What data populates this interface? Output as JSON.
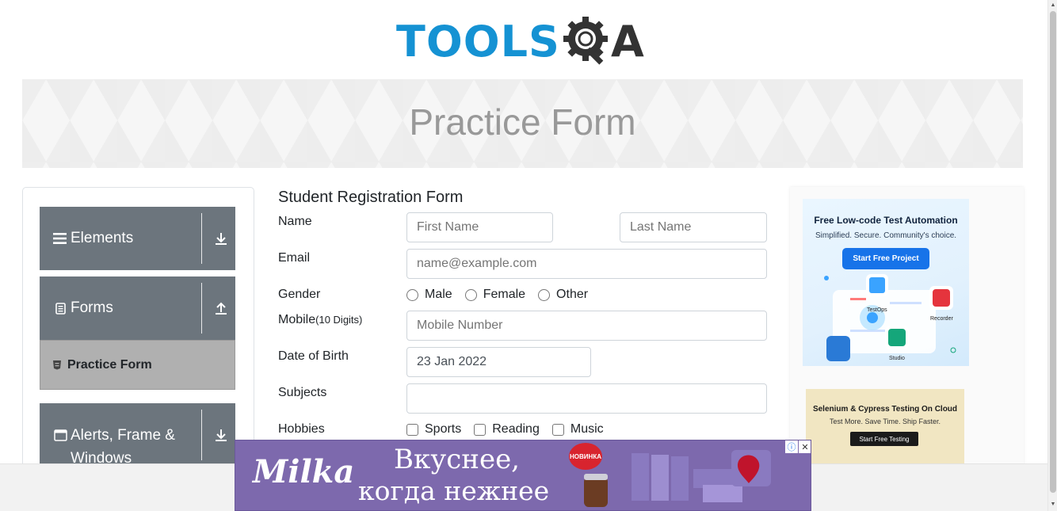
{
  "header": {
    "logo_text": "TOOLS",
    "logo_q_alt": "QA",
    "logo_a": "A"
  },
  "banner": {
    "title": "Practice Form"
  },
  "sidebar": {
    "groups": [
      {
        "label": "Elements",
        "icon": "hamburger-icon",
        "arrow": "download-arrow-icon"
      },
      {
        "label": "Forms",
        "icon": "document-icon",
        "arrow": "upload-arrow-icon"
      },
      {
        "label": "Alerts, Frame &",
        "label2": "Windows",
        "icon": "window-icon",
        "arrow": "download-arrow-icon"
      }
    ],
    "active_item": {
      "label": "Practice Form",
      "icon": "html-file-icon"
    }
  },
  "form": {
    "title": "Student Registration Form",
    "name_label": "Name",
    "first_name_placeholder": "First Name",
    "last_name_placeholder": "Last Name",
    "email_label": "Email",
    "email_placeholder": "name@example.com",
    "gender_label": "Gender",
    "gender_options": [
      "Male",
      "Female",
      "Other"
    ],
    "mobile_label": "Mobile",
    "mobile_hint": "(10 Digits)",
    "mobile_placeholder": "Mobile Number",
    "dob_label": "Date of Birth",
    "dob_value": "23 Jan 2022",
    "subjects_label": "Subjects",
    "subjects_value": "",
    "hobbies_label": "Hobbies",
    "hobbies_options": [
      "Sports",
      "Reading",
      "Music"
    ]
  },
  "ads": {
    "ad1": {
      "title": "Free Low-code Test Automation",
      "subtitle": "Simplified. Secure. Community's choice.",
      "button": "Start Free Project",
      "labels": [
        "TestOps",
        "Recorder",
        "Studio"
      ]
    },
    "ad2": {
      "title": "Selenium & Cypress Testing On Cloud",
      "subtitle": "Test More. Save Time. Ship Faster.",
      "button": "Start Free Testing"
    },
    "milka": {
      "brand": "Milka",
      "line1": "Вкуснее,",
      "line2": "когда нежнее",
      "badge": "НОВИНКА",
      "info_icon": "ⓘ",
      "close_icon": "✕"
    }
  },
  "colors": {
    "brand_blue": "#1592d3",
    "sidebar_group": "#6c757d",
    "active_item": "#b0b0b0",
    "milka_purple": "#7d69ad",
    "banner_title": "#999999"
  }
}
